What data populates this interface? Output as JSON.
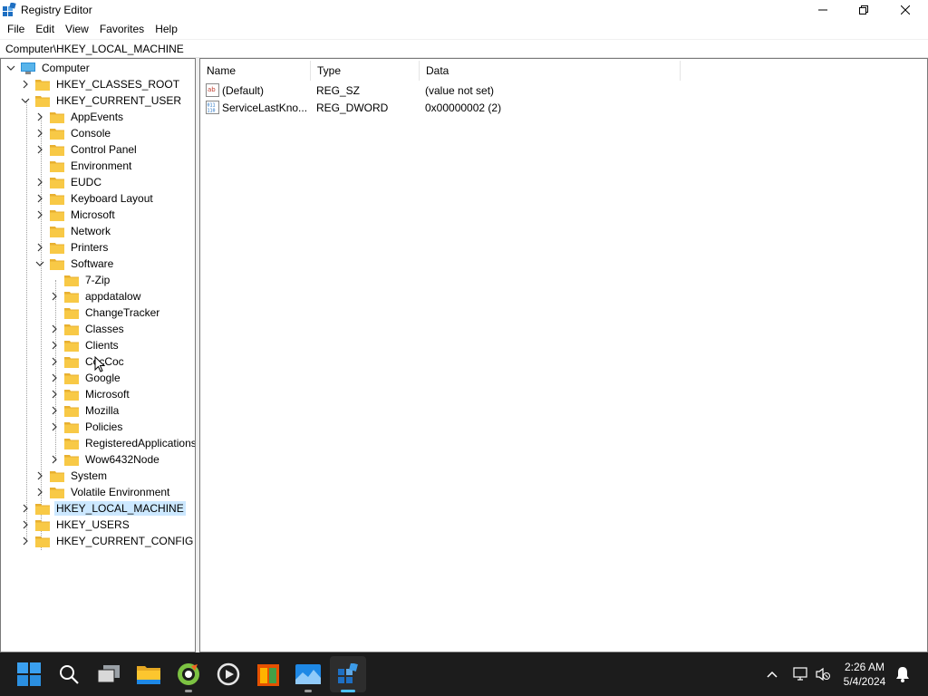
{
  "window": {
    "title": "Registry Editor"
  },
  "menu": [
    "File",
    "Edit",
    "View",
    "Favorites",
    "Help"
  ],
  "address": {
    "value": "Computer\\HKEY_LOCAL_MACHINE"
  },
  "tree": {
    "root": "Computer",
    "hives": {
      "classes_root": "HKEY_CLASSES_ROOT",
      "current_user": "HKEY_CURRENT_USER",
      "local_machine": "HKEY_LOCAL_MACHINE",
      "users": "HKEY_USERS",
      "current_config": "HKEY_CURRENT_CONFIG"
    },
    "current_user_children": [
      "AppEvents",
      "Console",
      "Control Panel",
      "Environment",
      "EUDC",
      "Keyboard Layout",
      "Microsoft",
      "Network",
      "Printers",
      "Software",
      "System",
      "Volatile Environment"
    ],
    "software_children": [
      "7-Zip",
      "appdatalow",
      "ChangeTracker",
      "Classes",
      "Clients",
      "CocCoc",
      "Google",
      "Microsoft",
      "Mozilla",
      "Policies",
      "RegisteredApplications",
      "Wow6432Node"
    ]
  },
  "list": {
    "columns": [
      "Name",
      "Type",
      "Data"
    ],
    "rows": [
      {
        "name": "(Default)",
        "type": "REG_SZ",
        "data": "(value not set)",
        "icon": "string-value-icon"
      },
      {
        "name": "ServiceLastKno...",
        "type": "REG_DWORD",
        "data": "0x00000002 (2)",
        "icon": "binary-value-icon"
      }
    ]
  },
  "taskbar": {
    "time": "2:26 AM",
    "date": "5/4/2024"
  },
  "colors": {
    "selection": "#cce8ff",
    "folder": "#f8c946",
    "taskbar": "#1c1c1c",
    "accent": "#4cc2ff"
  }
}
